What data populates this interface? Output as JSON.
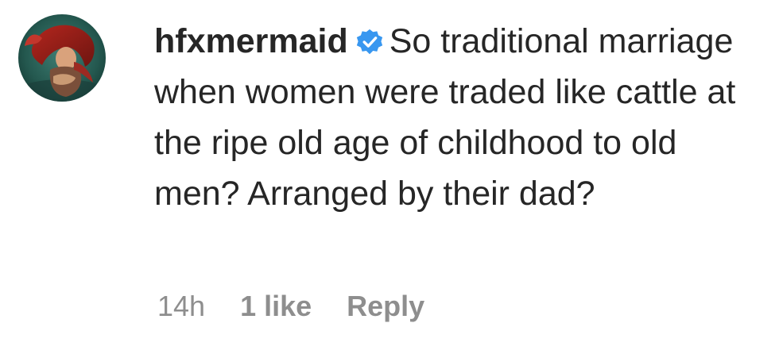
{
  "comment": {
    "username": "hfxmermaid",
    "verified_icon": "verified-badge-icon",
    "text": "So traditional marriage when women were traded like cattle at the ripe old age of childhood to old men? Arranged by their dad?",
    "avatar": "mermaid-underwater-avatar",
    "timestamp": "14h",
    "likes": "1 like",
    "reply_label": "Reply",
    "colors": {
      "text": "#262626",
      "muted": "#8e8e8e",
      "verified": "#3897f0"
    }
  }
}
